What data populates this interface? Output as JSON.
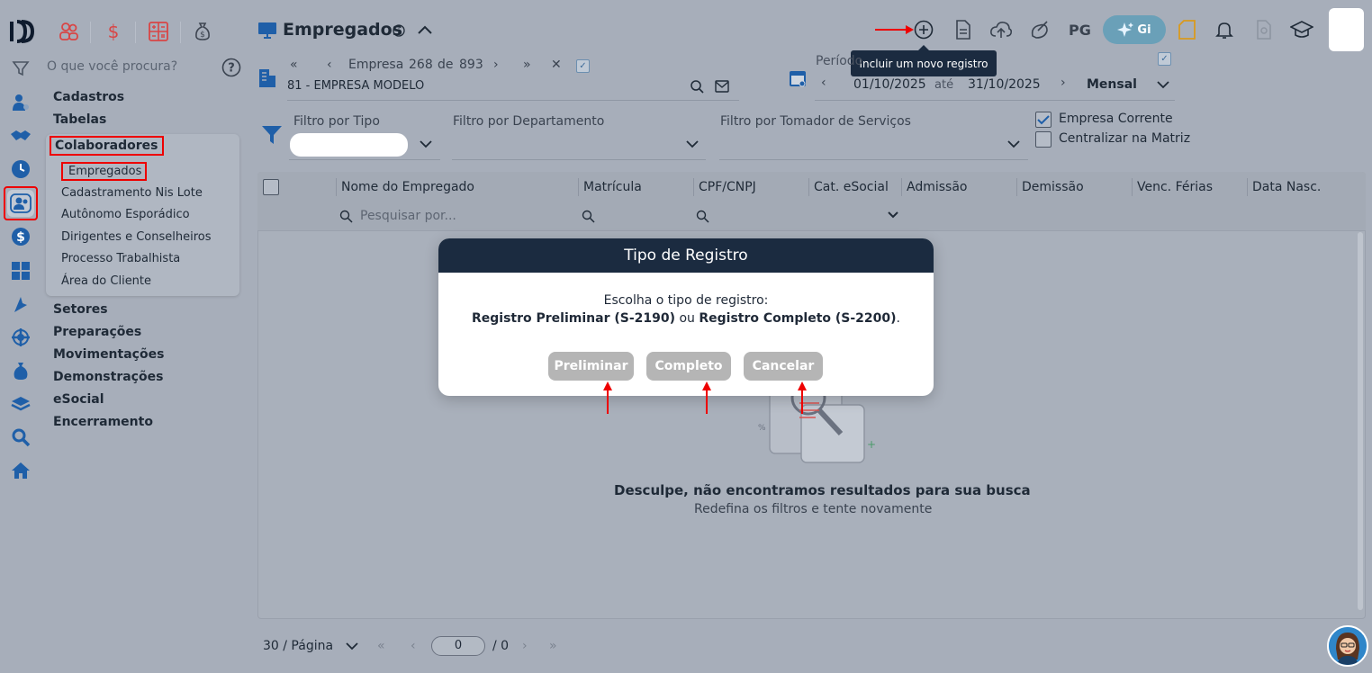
{
  "app": {
    "logo_text": "D"
  },
  "search": {
    "placeholder": "O que você procura?"
  },
  "menu": {
    "sections": [
      "Cadastros",
      "Tabelas",
      "Colaboradores",
      "Setores",
      "Preparações",
      "Movimentações",
      "Demonstrações",
      "eSocial",
      "Encerramento"
    ],
    "submenu": [
      "Empregados",
      "Cadastramento Nis Lote",
      "Autônomo Esporádico",
      "Dirigentes e Conselheiros",
      "Processo Trabalhista",
      "Área do Cliente"
    ]
  },
  "header": {
    "title": "Empregados",
    "pg_label": "PG",
    "gi_label": "Gi",
    "tooltip": "Incluir um novo registro"
  },
  "empresa": {
    "label": "Empresa",
    "current": "268",
    "of": "de",
    "total": "893",
    "name": "81 - EMPRESA MODELO"
  },
  "periodo": {
    "label": "Período",
    "start": "01/10/2025",
    "until": "até",
    "end": "31/10/2025",
    "mode": "Mensal"
  },
  "filters": {
    "tipo": "Filtro por Tipo",
    "departamento": "Filtro por Departamento",
    "tomador": "Filtro por Tomador de Serviços",
    "empresa_corrente": "Empresa Corrente",
    "centralizar": "Centralizar na Matriz"
  },
  "table": {
    "columns": [
      "Nome do Empregado",
      "Matrícula",
      "CPF/CNPJ",
      "Cat. eSocial",
      "Admissão",
      "Demissão",
      "Venc. Férias",
      "Data Nasc."
    ],
    "search_placeholder": "Pesquisar por..."
  },
  "empty": {
    "title": "Desculpe, não encontramos resultados para sua busca",
    "subtitle": "Redefina os filtros e tente novamente"
  },
  "pagination": {
    "per_page": "30 / Página",
    "page": "0",
    "total": "/ 0"
  },
  "modal": {
    "title": "Tipo de Registro",
    "line1": "Escolha o tipo de registro:",
    "opt1": "Registro Preliminar (S-2190)",
    "or": "ou",
    "opt2": "Registro Completo (S-2200)",
    "end": ".",
    "btn_preliminar": "Preliminar",
    "btn_completo": "Completo",
    "btn_cancelar": "Cancelar"
  },
  "colors": {
    "overlay_bg": "#a7aeba",
    "modal_header": "#1b2b40",
    "button_gray": "#b5b5b5",
    "highlight_red": "#ee0000"
  }
}
